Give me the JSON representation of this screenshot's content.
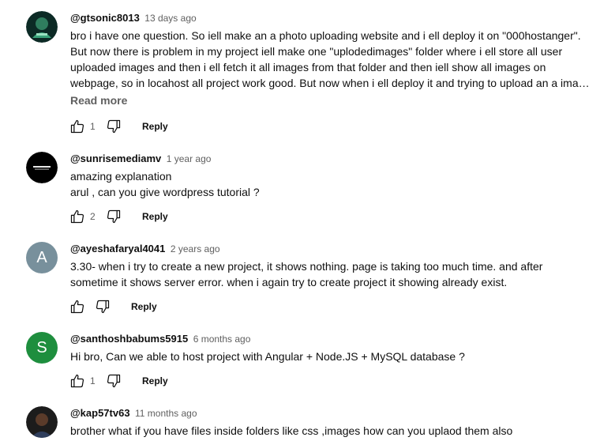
{
  "actions": {
    "reply_label": "Reply"
  },
  "comments": [
    {
      "author": "@gtsonic8013",
      "time": "13 days ago",
      "lines": [
        "bro i have one question. So iell make an a photo uploading website and i ell deploy it on \"000hostanger\".",
        "But now there is problem  in my project iell make one \"uplodedimages\" folder where i ell store all user",
        "uploaded images and then i ell fetch it all images from that folder and then iell  show all images on",
        "webpage, so in locahost all project work good. But now when i ell deploy it and trying to upload an a imag..."
      ],
      "read_more": "Read more",
      "likes": "1",
      "avatar_color": "#0c2a25"
    },
    {
      "author": "@sunrisemediamv",
      "time": "1 year ago",
      "lines": [
        "amazing explanation",
        "arul , can you give wordpress tutorial ?"
      ],
      "likes": "2",
      "avatar_color": "#000000"
    },
    {
      "author": "@ayeshafaryal4041",
      "time": "2 years ago",
      "lines": [
        "3.30- when i try to create a new project, it shows nothing. page is taking too much time. and after",
        "sometime it shows server error. when i again  try to create project it showing already exist."
      ],
      "likes": "",
      "avatar_letter": "A",
      "avatar_color": "#78909c"
    },
    {
      "author": "@santhoshbabums5915",
      "time": "6 months ago",
      "lines": [
        "Hi bro, Can we able to host project with Angular + Node.JS + MySQL database ?"
      ],
      "likes": "1",
      "avatar_letter": "S",
      "avatar_color": "#1e8e3e"
    },
    {
      "author": "@kap57tv63",
      "time": "11 months ago",
      "lines": [
        "brother what if  you have files inside folders like css ,images how can you uplaod them also"
      ],
      "likes": "",
      "avatar_color": "#1c1c1c"
    }
  ]
}
